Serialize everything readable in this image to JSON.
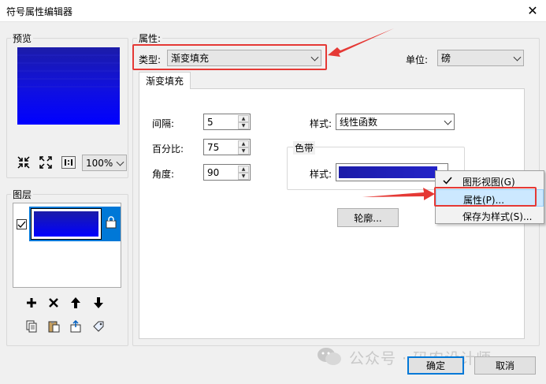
{
  "window": {
    "title": "符号属性编辑器",
    "close_glyph": "✕"
  },
  "preview": {
    "label": "预览",
    "zoom": "100%",
    "gradient_colors": [
      "#1c1ca8",
      "#0000ff"
    ]
  },
  "layers": {
    "label": "图层"
  },
  "properties": {
    "label": "属性:",
    "type_label": "类型:",
    "type_value": "渐变填充",
    "unit_label": "单位:",
    "unit_value": "磅",
    "tab_label": "渐变填充",
    "interval_label": "间隔:",
    "interval_value": "5",
    "percent_label": "百分比:",
    "percent_value": "75",
    "angle_label": "角度:",
    "angle_value": "90",
    "style_label": "样式:",
    "style_value": "线性函数",
    "ramp_group_label": "色带",
    "ramp_style_label": "样式:",
    "outline_button": "轮廓..."
  },
  "context_menu": {
    "items": [
      "图形视图(G)",
      "属性(P)...",
      "保存为样式(S)..."
    ],
    "checked_index": 0,
    "highlighted_index": 1
  },
  "footer": {
    "ok": "确定",
    "cancel": "取消",
    "watermark": "公众号 · 码农设计师"
  },
  "colors": {
    "accent": "#0078d7",
    "annotation_red": "#e53935",
    "ramp_dark": "#1c1ca8",
    "ramp_light": "#2323c8"
  }
}
